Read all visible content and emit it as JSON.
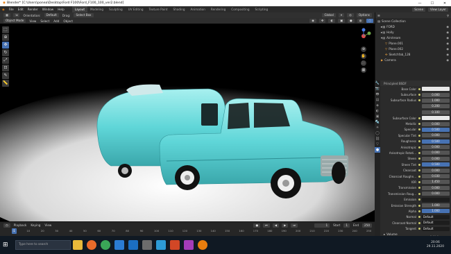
{
  "window": {
    "title": "Blender* [C:\\Users\\ponea\\Desktop\\Ford F100\\Ford_F100_100_ver2.blend]",
    "controls": [
      "—",
      "☐",
      "✕"
    ]
  },
  "menu": {
    "items": [
      "File",
      "Edit",
      "Render",
      "Window",
      "Help"
    ],
    "workspaces": [
      "Layout",
      "Modeling",
      "Sculpting",
      "UV Editing",
      "Texture Paint",
      "Shading",
      "Animation",
      "Rendering",
      "Compositing",
      "Scripting"
    ],
    "active_workspace": "Layout",
    "scene_label": "Scene",
    "viewlayer_label": "View Layer"
  },
  "header": {
    "orientation_label": "Orientation:",
    "orientation_value": "Default",
    "drag_label": "Drag:",
    "drag_value": "Select Box",
    "global_value": "Global",
    "options_label": "Options"
  },
  "viewport_header": {
    "mode": "Object Mode",
    "menus": [
      "View",
      "Select",
      "Add",
      "Object"
    ]
  },
  "outliner": {
    "title": "Scene Collection",
    "rows": [
      {
        "name": "Scene Collection",
        "indent": 0,
        "icon": "collection-icon"
      },
      {
        "name": "FORD",
        "indent": 1,
        "icon": "collection-icon"
      },
      {
        "name": "Holly",
        "indent": 1,
        "icon": "collection-icon"
      },
      {
        "name": "Airstream",
        "indent": 1,
        "icon": "collection-icon"
      },
      {
        "name": "Plane.001",
        "indent": 2,
        "icon": "mesh-icon"
      },
      {
        "name": "Plane.002",
        "indent": 2,
        "icon": "mesh-icon"
      },
      {
        "name": "Sketchfab_128",
        "indent": 2,
        "icon": "empty-icon"
      },
      {
        "name": "Camera",
        "indent": 1,
        "icon": "camera-icon"
      }
    ]
  },
  "properties": {
    "section": "Principled BSDF",
    "rows": [
      {
        "label": "Base Color",
        "value": "",
        "kind": "white"
      },
      {
        "label": "Subsurface",
        "value": "0.000",
        "kind": "normal"
      },
      {
        "label": "Subsurface Radius",
        "value": "1.000",
        "kind": "normal"
      },
      {
        "label": "",
        "value": "0.200",
        "kind": "normal"
      },
      {
        "label": "",
        "value": "0.100",
        "kind": "normal"
      },
      {
        "label": "Subsurface Color",
        "value": "",
        "kind": "white"
      },
      {
        "label": "Metallic",
        "value": "0.000",
        "kind": "normal"
      },
      {
        "label": "Specular",
        "value": "0.500",
        "kind": "blue"
      },
      {
        "label": "Specular Tint",
        "value": "0.000",
        "kind": "normal"
      },
      {
        "label": "Roughness",
        "value": "0.500",
        "kind": "blue"
      },
      {
        "label": "Anisotropic",
        "value": "0.000",
        "kind": "normal"
      },
      {
        "label": "Anisotropic Rotati...",
        "value": "0.000",
        "kind": "normal"
      },
      {
        "label": "Sheen",
        "value": "0.000",
        "kind": "normal"
      },
      {
        "label": "Sheen Tint",
        "value": "0.500",
        "kind": "blue"
      },
      {
        "label": "Clearcoat",
        "value": "0.000",
        "kind": "normal"
      },
      {
        "label": "Clearcoat Roughn...",
        "value": "0.030",
        "kind": "normal"
      },
      {
        "label": "IOR",
        "value": "1.450",
        "kind": "normal"
      },
      {
        "label": "Transmission",
        "value": "0.000",
        "kind": "normal"
      },
      {
        "label": "Transmission Roug...",
        "value": "0.000",
        "kind": "normal"
      },
      {
        "label": "Emission",
        "value": "",
        "kind": "dark"
      },
      {
        "label": "Emission Strength",
        "value": "1.000",
        "kind": "normal"
      },
      {
        "label": "Alpha",
        "value": "1.000",
        "kind": "blue"
      },
      {
        "label": "Normal",
        "value": "Default",
        "kind": "dark"
      },
      {
        "label": "Clearcoat Normal",
        "value": "Default",
        "kind": "dark"
      },
      {
        "label": "Tangent",
        "value": "Default",
        "kind": "dark"
      }
    ],
    "footer": "Volume"
  },
  "timeline": {
    "menus": [
      "Playback",
      "Keying",
      "View"
    ],
    "current_frame": "1",
    "start_label": "Start",
    "start_value": "1",
    "end_label": "End",
    "end_value": "250",
    "frame_ticks": [
      "0",
      "10",
      "20",
      "30",
      "40",
      "50",
      "60",
      "70",
      "80",
      "90",
      "100",
      "110",
      "120",
      "130",
      "140",
      "150",
      "160",
      "170",
      "180",
      "190",
      "200",
      "210",
      "220",
      "230",
      "240",
      "250"
    ]
  },
  "status": {
    "pan": "Pan View",
    "context": "Context Menu",
    "version": "2.91.0"
  },
  "taskbar": {
    "search_placeholder": "Type here to search",
    "time": "20:06",
    "date": "29.11.2020",
    "icons": [
      "files-icon",
      "firefox-icon",
      "chrome-icon",
      "explorer-icon",
      "mail-icon",
      "store-icon",
      "photos-icon",
      "office-icon",
      "app-icon",
      "blender-icon"
    ]
  },
  "colors": {
    "accent": "#4772b3",
    "truck_body": "#5fd6d8",
    "viewport_bg": "#000000"
  }
}
